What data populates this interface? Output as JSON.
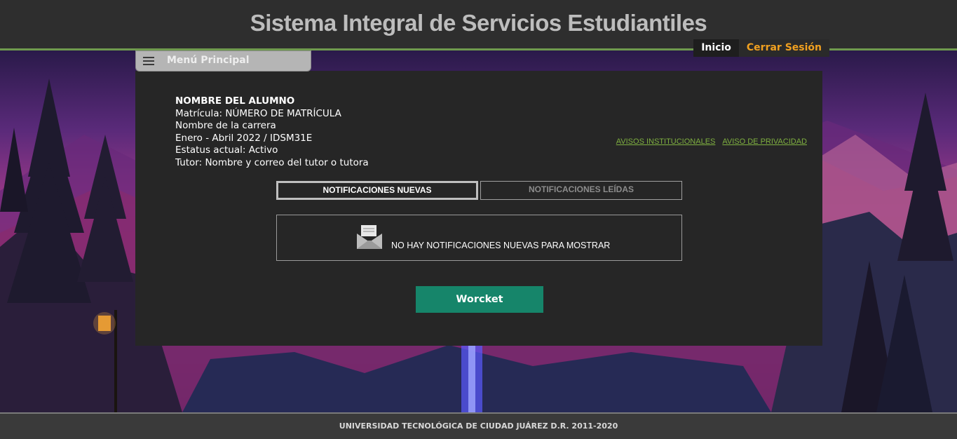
{
  "header": {
    "title": "Sistema Integral de Servicios Estudiantiles"
  },
  "topnav": {
    "inicio": "Inicio",
    "cerrar_sesion": "Cerrar Sesión"
  },
  "menu": {
    "label": "Menú Principal",
    "icon": "hamburger-menu-icon"
  },
  "student": {
    "name": "NOMBRE DEL ALUMNO",
    "matricula": "Matrícula: NÚMERO DE MATRÍCULA",
    "carrera": "Nombre de la carrera",
    "periodo": "Enero - Abril 2022 / IDSM31E",
    "estatus": "Estatus actual: Activo",
    "tutor": "Tutor: Nombre y correo del tutor o tutora"
  },
  "links": {
    "avisos": "AVISOS INSTITUCIONALES",
    "privacidad": "AVISO DE PRIVACIDAD"
  },
  "tabs": {
    "nuevas": "NOTIFICACIONES NUEVAS",
    "leidas": "NOTIFICACIONES LEÍDAS"
  },
  "notifications": {
    "empty_message": "NO HAY NOTIFICACIONES NUEVAS PARA MOSTRAR",
    "icon": "envelope-icon"
  },
  "action": {
    "worcket_label": "Worcket"
  },
  "footer": {
    "text": "UNIVERSIDAD TECNOLÓGICA DE CIUDAD JUÁREZ D.R. 2011-2020"
  },
  "colors": {
    "accent_green": "#16856a",
    "link_green": "#7fb040",
    "logout_orange": "#f0a020",
    "header_line": "#6f9a4e"
  }
}
